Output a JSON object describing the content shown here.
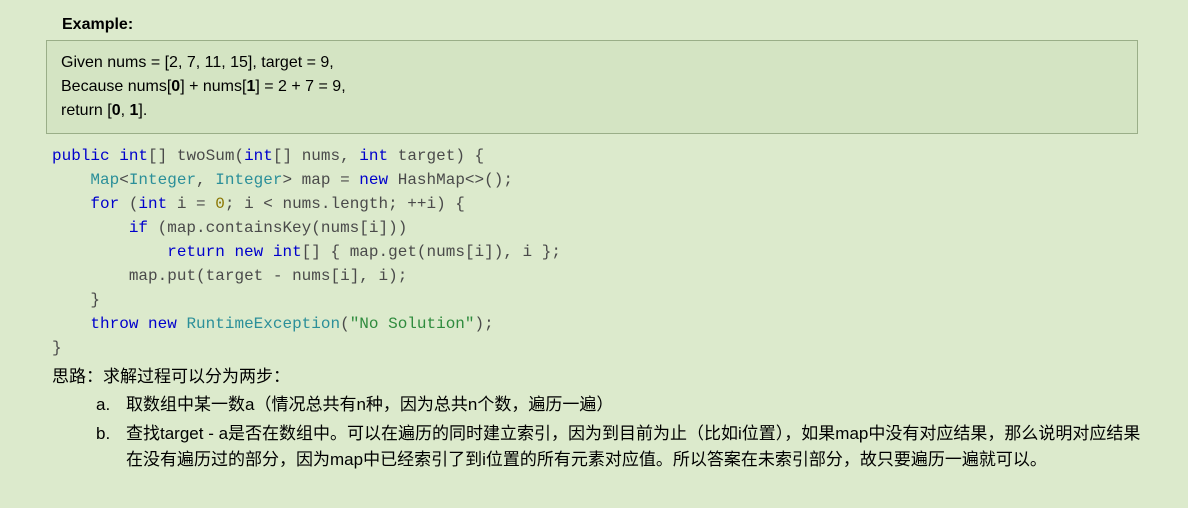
{
  "heading": "Example:",
  "example": {
    "line1_pre": "Given nums = [2, 7, 11, 15], target = 9,",
    "line2_pre": "Because nums[",
    "line2_b0": "0",
    "line2_mid": "] + nums[",
    "line2_b1": "1",
    "line2_post": "] = 2 + 7 = 9,",
    "line3_pre": "return [",
    "line3_b0": "0",
    "line3_sep": ", ",
    "line3_b1": "1",
    "line3_post": "]."
  },
  "code": {
    "l1": {
      "t0": "public",
      "t1": " ",
      "t2": "int",
      "t3": "[] ",
      "t4": "twoSum",
      "t5": "(",
      "t6": "int",
      "t7": "[] ",
      "t8": "nums",
      "t9": ", ",
      "t10": "int",
      "t11": " ",
      "t12": "target",
      "t13": ") {"
    },
    "l2": {
      "t0": "    ",
      "t1": "Map",
      "t2": "<",
      "t3": "Integer",
      "t4": ", ",
      "t5": "Integer",
      "t6": "> ",
      "t7": "map",
      "t8": " = ",
      "t9": "new",
      "t10": " HashMap<>();"
    },
    "l3": {
      "t0": "    ",
      "t1": "for",
      "t2": " (",
      "t3": "int",
      "t4": " i = ",
      "t5": "0",
      "t6": "; i < ",
      "t7": "nums",
      "t8": ".",
      "t9": "length",
      "t10": "; ++i) {"
    },
    "l4": {
      "t0": "        ",
      "t1": "if",
      "t2": " (",
      "t3": "map",
      "t4": ".",
      "t5": "containsKey",
      "t6": "(",
      "t7": "nums",
      "t8": "[i]))"
    },
    "l5": {
      "t0": "            ",
      "t1": "return",
      "t2": " ",
      "t3": "new",
      "t4": " ",
      "t5": "int",
      "t6": "[] { ",
      "t7": "map",
      "t8": ".",
      "t9": "get",
      "t10": "(",
      "t11": "nums",
      "t12": "[i]), i };"
    },
    "l6": {
      "t0": "        ",
      "t1": "map",
      "t2": ".",
      "t3": "put",
      "t4": "(",
      "t5": "target",
      "t6": " - ",
      "t7": "nums",
      "t8": "[i], i);"
    },
    "l7": {
      "t0": "    }"
    },
    "l8": {
      "t0": "    ",
      "t1": "throw",
      "t2": " ",
      "t3": "new",
      "t4": " ",
      "t5": "RuntimeException",
      "t6": "(",
      "t7": "\"No Solution\"",
      "t8": ");"
    },
    "l9": {
      "t0": "}"
    }
  },
  "explain": {
    "intro": "思路：求解过程可以分为两步：",
    "items": [
      {
        "marker": "a.",
        "body": "取数组中某一数a（情况总共有n种，因为总共n个数，遍历一遍）"
      },
      {
        "marker": "b.",
        "body": "查找target - a是否在数组中。可以在遍历的同时建立索引，因为到目前为止（比如i位置），如果map中没有对应结果，那么说明对应结果在没有遍历过的部分，因为map中已经索引了到i位置的所有元素对应值。所以答案在未索引部分，故只要遍历一遍就可以。"
      }
    ]
  }
}
